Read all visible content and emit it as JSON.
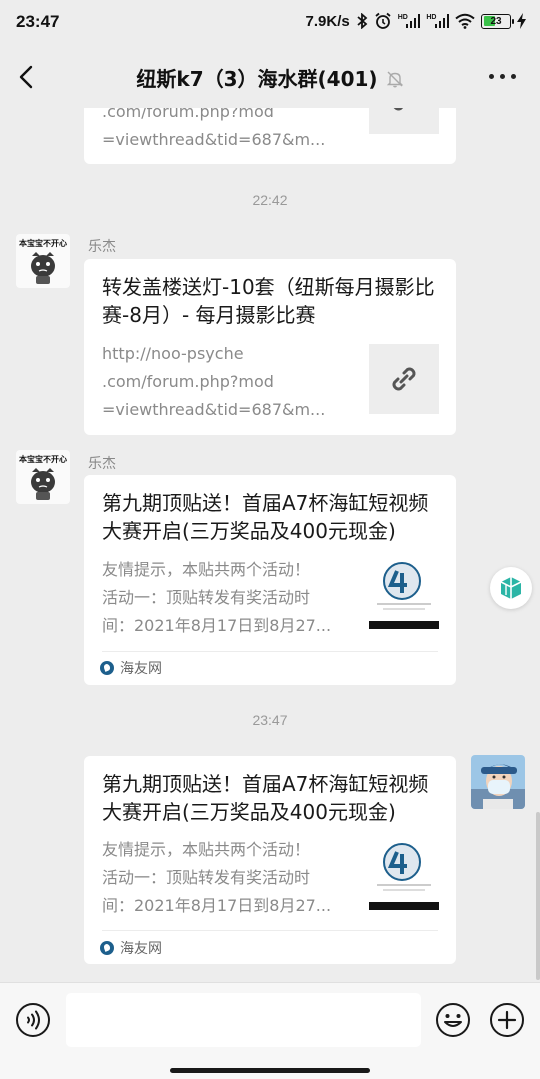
{
  "status_bar": {
    "time": "23:47",
    "net_speed": "7.9K/s",
    "hd1": "HD",
    "hd2": "HD",
    "battery": "23"
  },
  "header": {
    "title": "纽斯k7（3）海水群(401)",
    "back_icon": "chevron-left-icon",
    "mute_icon": "bell-off-icon",
    "more_icon": "more-dots-icon"
  },
  "messages": [
    {
      "type": "link",
      "desc_lines": [
        ".com/forum.php?mod",
        "=viewthread&tid=687&m..."
      ],
      "thumb": "link-icon"
    },
    {
      "type": "time",
      "text": "22:42"
    },
    {
      "type": "link",
      "sender": "乐杰",
      "avatar_caption": "本宝宝不开心",
      "title": "转发盖楼送灯-10套（纽斯每月摄影比赛-8月）- 每月摄影比赛",
      "desc_lines": [
        "http://noo-psyche",
        ".com/forum.php?mod",
        "=viewthread&tid=687&m..."
      ],
      "thumb": "link-icon"
    },
    {
      "type": "article",
      "sender": "乐杰",
      "avatar_caption": "本宝宝不开心",
      "title": "第九期顶贴送！首届A7杯海缸短视频大赛开启(三万奖品及400元现金)",
      "desc_lines": [
        "友情提示，本贴共两个活动！",
        "活动一：顶贴转发有奖活动时",
        "间：2021年8月17日到8月27..."
      ],
      "source": "海友网"
    },
    {
      "type": "time",
      "text": "23:47"
    },
    {
      "type": "article",
      "self": true,
      "title": "第九期顶贴送！首届A7杯海缸短视频大赛开启(三万奖品及400元现金)",
      "desc_lines": [
        "友情提示，本贴共两个活动！",
        "活动一：顶贴转发有奖活动时",
        "间：2021年8月17日到8月27..."
      ],
      "source": "海友网"
    }
  ],
  "input_bar": {
    "voice_icon": "voice-icon",
    "message_value": "",
    "emoji_icon": "emoji-icon",
    "plus_icon": "plus-icon"
  },
  "colors": {
    "background": "#ededed",
    "card": "#ffffff",
    "text": "#191919",
    "muted_text": "#8a8a8a",
    "battery_green": "#3bc24a"
  }
}
